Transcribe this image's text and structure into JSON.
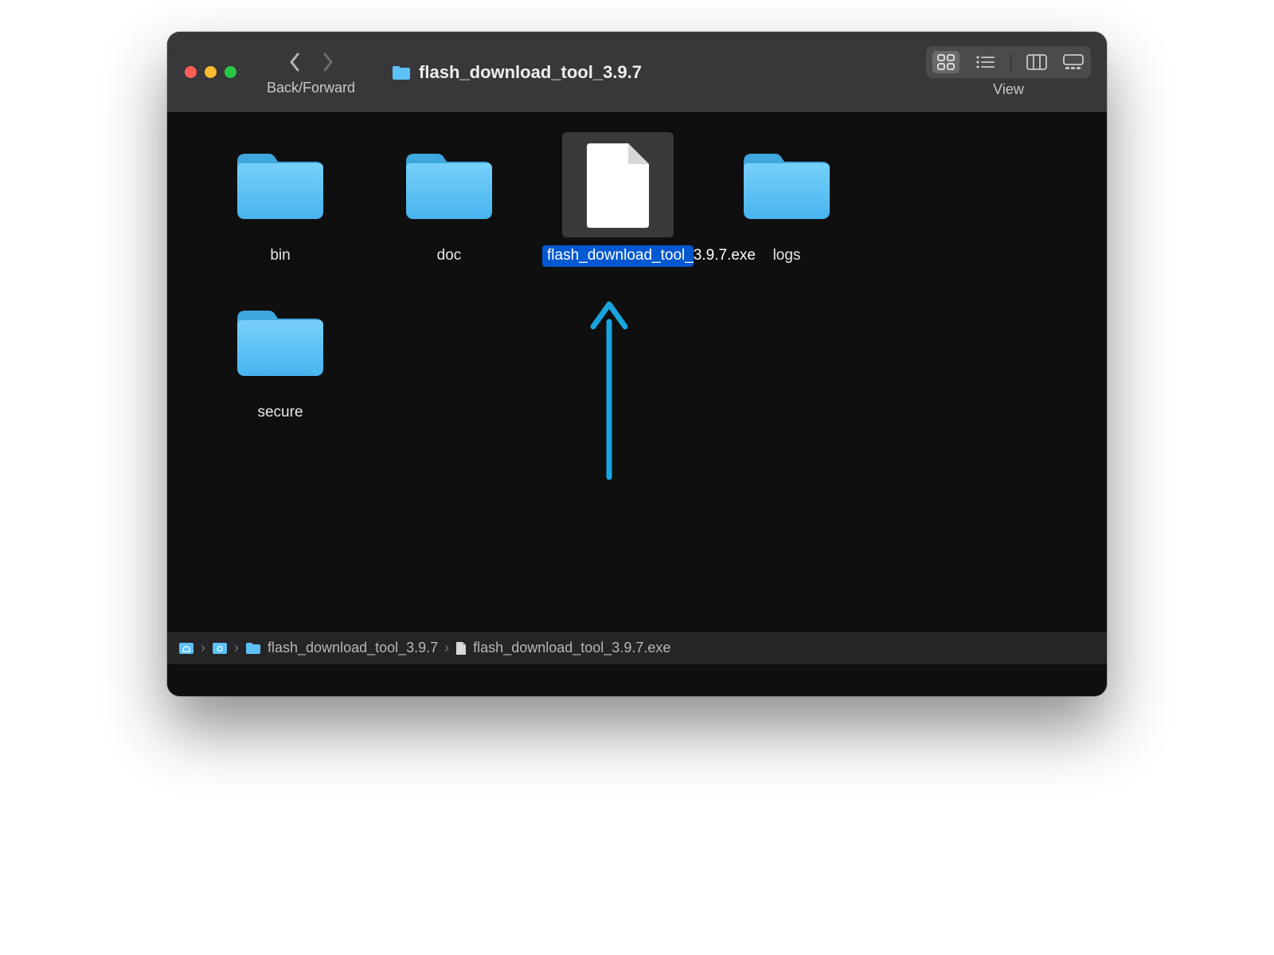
{
  "toolbar": {
    "nav_label": "Back/Forward",
    "title": "flash_download_tool_3.9.7",
    "view_label": "View"
  },
  "items": [
    {
      "name": "bin",
      "type": "folder",
      "selected": false
    },
    {
      "name": "doc",
      "type": "folder",
      "selected": false
    },
    {
      "name": "flash_download_tool_3.9.7.exe",
      "type": "file",
      "selected": true
    },
    {
      "name": "logs",
      "type": "folder",
      "selected": false
    },
    {
      "name": "secure",
      "type": "folder",
      "selected": false
    }
  ],
  "pathbar": {
    "segments": [
      {
        "name": "",
        "type": "home"
      },
      {
        "name": "",
        "type": "folder"
      },
      {
        "name": "flash_download_tool_3.9.7",
        "type": "folder"
      },
      {
        "name": "flash_download_tool_3.9.7.exe",
        "type": "file"
      }
    ]
  },
  "colors": {
    "folder": "#5dc1f5",
    "selection": "#0158d0",
    "annotation": "#1aa5de"
  }
}
